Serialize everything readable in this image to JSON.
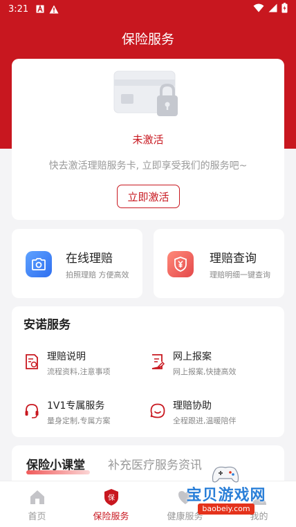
{
  "status_bar": {
    "time": "3:21",
    "icons_left": [
      "a-icon",
      "warning-icon"
    ],
    "icons_right": [
      "wifi-icon",
      "signal-icon",
      "battery-icon"
    ]
  },
  "header": {
    "title": "保险服务"
  },
  "activation": {
    "status": "未激活",
    "description": "快去激活理赔服务卡, 立即享受我们的服务吧~",
    "button_label": "立即激活"
  },
  "features": [
    {
      "title": "在线理赔",
      "subtitle": "拍照理赔 方便高效",
      "icon": "camera-icon",
      "color": "#3a7ff5"
    },
    {
      "title": "理赔查询",
      "subtitle": "理赔明细一键查询",
      "icon": "yen-shield-icon",
      "color": "#ec5a56"
    }
  ],
  "services": {
    "title": "安诺服务",
    "items": [
      {
        "title": "理赔说明",
        "subtitle": "流程资料,注意事项",
        "icon": "document-icon"
      },
      {
        "title": "网上报案",
        "subtitle": "网上报案,快捷高效",
        "icon": "edit-document-icon"
      },
      {
        "title": "1V1专属服务",
        "subtitle": "量身定制,专属方案",
        "icon": "headset-icon"
      },
      {
        "title": "理赔协助",
        "subtitle": "全程跟进,温暖陪伴",
        "icon": "smile-chat-icon"
      }
    ]
  },
  "tabs": [
    {
      "label": "保险小课堂",
      "active": true
    },
    {
      "label": "补充医疗服务资讯",
      "active": false
    }
  ],
  "bottom_nav": [
    {
      "label": "首页",
      "icon": "home-icon",
      "active": false
    },
    {
      "label": "保险服务",
      "icon": "insurance-shield-icon",
      "active": true
    },
    {
      "label": "健康服务",
      "icon": "health-icon",
      "active": false
    },
    {
      "label": "我的",
      "icon": "profile-icon",
      "active": false
    }
  ],
  "watermark": {
    "text": "宝贝游戏网",
    "url": "baobeiy.com"
  },
  "colors": {
    "brand_red": "#c8171f",
    "background": "#f4f4f6"
  }
}
